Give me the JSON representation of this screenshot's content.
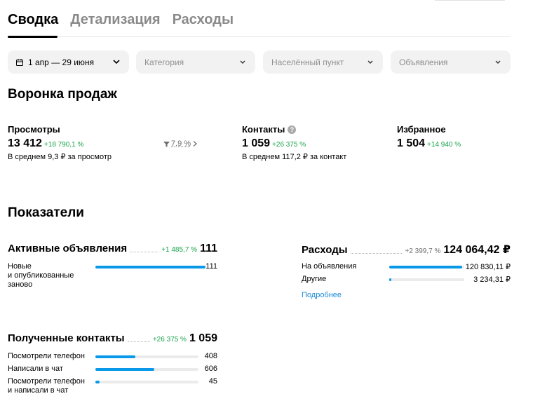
{
  "tabs": [
    {
      "label": "Сводка",
      "active": true
    },
    {
      "label": "Детализация",
      "active": false
    },
    {
      "label": "Расходы",
      "active": false
    }
  ],
  "filters": {
    "date": "1 апр — 29 июня",
    "category": "Категория",
    "city": "Населённый пункт",
    "ads": "Объявления"
  },
  "funnel": {
    "title": "Воронка продаж",
    "views": {
      "label": "Просмотры",
      "value": "13 412",
      "delta": "+18 790,1 %",
      "sub": "В среднем 9,3 ₽ за просмотр"
    },
    "conversion": "7,9 %",
    "contacts": {
      "label": "Контакты",
      "value": "1 059",
      "delta": "+26 375 %",
      "sub": "В среднем 117,2 ₽ за контакт"
    },
    "favorites": {
      "label": "Избранное",
      "value": "1 504",
      "delta": "+14 940 %"
    }
  },
  "indicators": {
    "title": "Показатели",
    "active_ads": {
      "title": "Активные объявления",
      "delta": "+1 485,7 %",
      "total": "111",
      "rows": [
        {
          "label_line1": "Новые",
          "label_line2": "и опубликованные",
          "label_line3": "заново",
          "value": "111",
          "share": 1.0
        }
      ]
    },
    "expenses": {
      "title": "Расходы",
      "delta": "+2 399,7 %",
      "total": "124 064,42 ₽",
      "rows": [
        {
          "label": "На объявления",
          "value": "120 830,11 ₽",
          "share": 0.97
        },
        {
          "label": "Другие",
          "value": "3 234,31 ₽",
          "share": 0.03
        }
      ],
      "more_link": "Подробнее"
    },
    "contacts": {
      "title": "Полученные контакты",
      "delta": "+26 375 %",
      "total": "1 059",
      "rows": [
        {
          "label": "Посмотрели телефон",
          "value": "408",
          "share": 0.385
        },
        {
          "label": "Написали в чат",
          "value": "606",
          "share": 0.572
        },
        {
          "label_line1": "Посмотрели телефон",
          "label_line2": "и написали в чат",
          "value": "45",
          "share": 0.042
        }
      ]
    }
  },
  "colors": {
    "accent": "#0a99e8",
    "positive": "#19a34a",
    "muted": "#8a8a8a"
  }
}
